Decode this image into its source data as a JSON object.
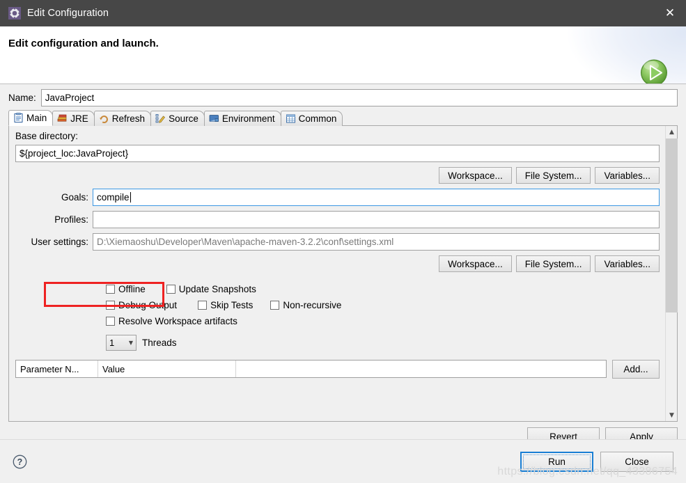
{
  "window": {
    "title": "Edit Configuration",
    "title_icon": "gear-icon",
    "close_icon": "✕"
  },
  "banner": {
    "title": "Edit configuration and launch.",
    "icon": "run-play-icon"
  },
  "name_field": {
    "label": "Name:",
    "value": "JavaProject"
  },
  "tabs": [
    {
      "label": "Main",
      "icon": "clipboard-icon",
      "selected": true
    },
    {
      "label": "JRE",
      "icon": "books-icon",
      "selected": false
    },
    {
      "label": "Refresh",
      "icon": "refresh-icon",
      "selected": false
    },
    {
      "label": "Source",
      "icon": "pencil-icon",
      "selected": false
    },
    {
      "label": "Environment",
      "icon": "monitor-icon",
      "selected": false
    },
    {
      "label": "Common",
      "icon": "table-icon",
      "selected": false
    }
  ],
  "main_tab": {
    "base_directory": {
      "label": "Base directory:",
      "value": "${project_loc:JavaProject}"
    },
    "browse_buttons_top": [
      "Workspace...",
      "File System...",
      "Variables..."
    ],
    "goals": {
      "label": "Goals:",
      "value": "compile"
    },
    "profiles": {
      "label": "Profiles:",
      "value": ""
    },
    "user_settings": {
      "label": "User settings:",
      "value": "D:\\Xiemaoshu\\Developer\\Maven\\apache-maven-3.2.2\\conf\\settings.xml"
    },
    "browse_buttons_bottom": [
      "Workspace...",
      "File System...",
      "Variables..."
    ],
    "checkboxes": [
      {
        "label": "Offline",
        "checked": false
      },
      {
        "label": "Update Snapshots",
        "checked": false
      },
      {
        "label": "Debug Output",
        "checked": false
      },
      {
        "label": "Skip Tests",
        "checked": false
      },
      {
        "label": "Non-recursive",
        "checked": false
      },
      {
        "label": "Resolve Workspace artifacts",
        "checked": false
      }
    ],
    "threads": {
      "value": "1",
      "label": "Threads"
    },
    "parameter_table": {
      "columns": [
        "Parameter N...",
        "Value"
      ],
      "rows": [],
      "add_button": "Add..."
    }
  },
  "bottom_actions": {
    "revert": "Revert",
    "apply": "Apply"
  },
  "footer": {
    "help_icon": "help-question-icon",
    "run": "Run",
    "close": "Close",
    "watermark": "https://blog.csdn.net/qq_43386754"
  },
  "colors": {
    "titlebar": "#474747",
    "dialog_bg": "#f0f0f0",
    "accent_blue": "#1a7fd4",
    "annotation_red": "#ee2222",
    "focus_border": "#3b97e3",
    "run_icon_green": "#76bc45"
  }
}
